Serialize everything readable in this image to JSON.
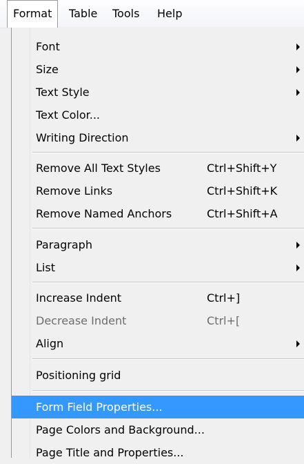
{
  "menubar": {
    "items": [
      {
        "label": "Format",
        "active": true
      },
      {
        "label": "Table",
        "active": false
      },
      {
        "label": "Tools",
        "active": false
      },
      {
        "label": "Help",
        "active": false
      }
    ]
  },
  "menu": {
    "items": [
      {
        "label": "Font",
        "submenu": true
      },
      {
        "label": "Size",
        "submenu": true
      },
      {
        "label": "Text Style",
        "submenu": true
      },
      {
        "label": "Text Color...",
        "submenu": false
      },
      {
        "label": "Writing Direction",
        "submenu": true
      },
      {
        "separator": true
      },
      {
        "label": "Remove All Text Styles",
        "shortcut": "Ctrl+Shift+Y"
      },
      {
        "label": "Remove Links",
        "shortcut": "Ctrl+Shift+K"
      },
      {
        "label": "Remove Named Anchors",
        "shortcut": "Ctrl+Shift+A"
      },
      {
        "separator": true
      },
      {
        "label": "Paragraph",
        "submenu": true
      },
      {
        "label": "List",
        "submenu": true
      },
      {
        "separator": true
      },
      {
        "label": "Increase Indent",
        "shortcut": "Ctrl+]"
      },
      {
        "label": "Decrease Indent",
        "shortcut": "Ctrl+[",
        "disabled": true
      },
      {
        "label": "Align",
        "submenu": true
      },
      {
        "separator": true
      },
      {
        "label": "Positioning grid"
      },
      {
        "separator": true
      },
      {
        "label": "Form Field Properties...",
        "highlighted": true
      },
      {
        "label": "Page Colors and Background..."
      },
      {
        "label": "Page Title and Properties..."
      }
    ]
  },
  "colors": {
    "highlight": "#3399ff",
    "disabled_text": "#6d6d6d",
    "menu_bg": "#f0f0f0"
  }
}
